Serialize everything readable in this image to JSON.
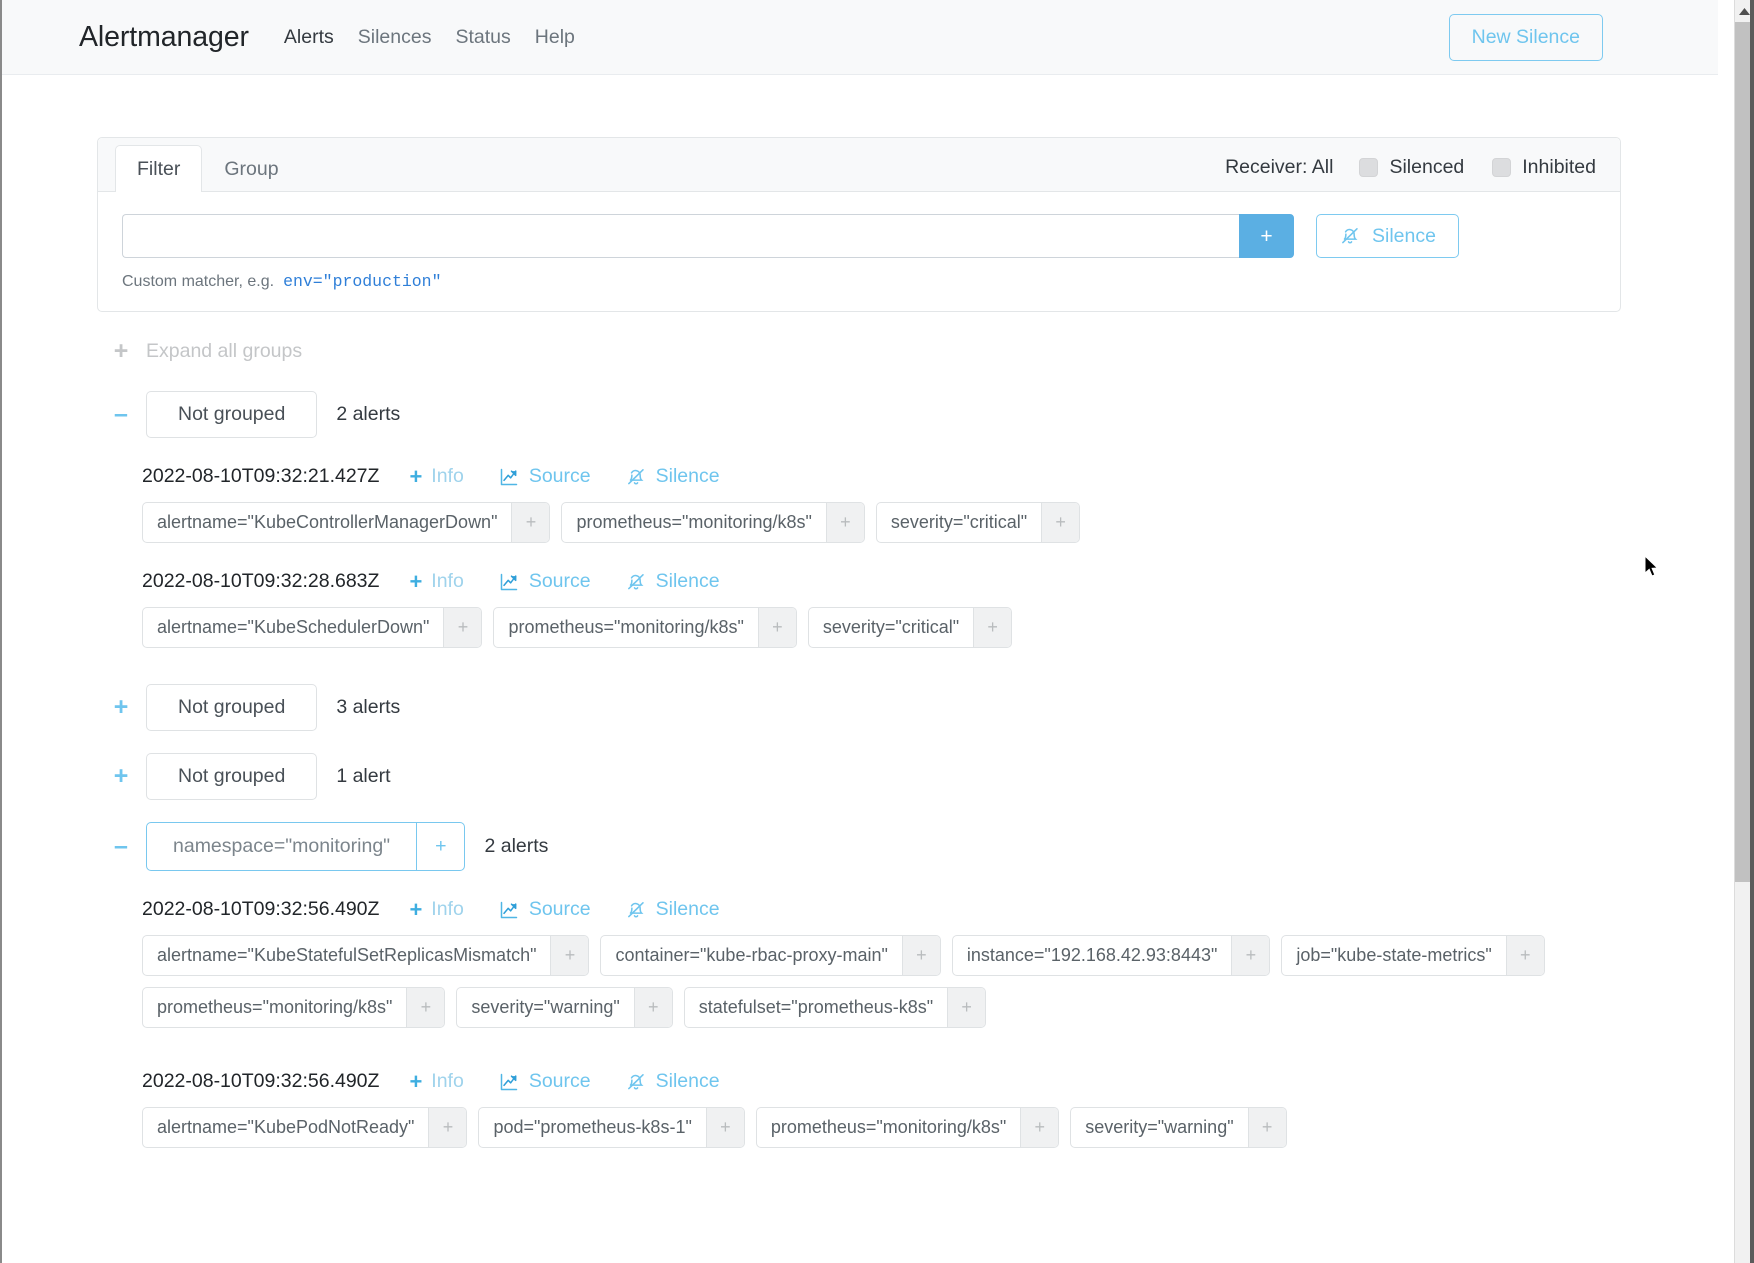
{
  "navbar": {
    "brand": "Alertmanager",
    "links": [
      {
        "label": "Alerts",
        "active": true
      },
      {
        "label": "Silences",
        "active": false
      },
      {
        "label": "Status",
        "active": false
      },
      {
        "label": "Help",
        "active": false
      }
    ],
    "new_silence_label": "New Silence"
  },
  "filter_card": {
    "tabs": [
      {
        "label": "Filter",
        "active": true
      },
      {
        "label": "Group",
        "active": false
      }
    ],
    "receiver_label": "Receiver: All",
    "checkboxes": [
      {
        "label": "Silenced",
        "checked": false
      },
      {
        "label": "Inhibited",
        "checked": false
      }
    ],
    "input_value": "",
    "input_placeholder": "",
    "add_button_label": "+",
    "silence_button_label": "Silence",
    "hint_prefix": "Custom matcher, e.g.",
    "hint_code": "env=\"production\""
  },
  "expand_all": {
    "icon": "plus-icon",
    "label": "Expand all groups"
  },
  "groups": [
    {
      "toggle": "minus-icon",
      "expanded": true,
      "chip_type": "plain",
      "chip_label": "Not grouped",
      "count_label": "2 alerts",
      "alerts": [
        {
          "timestamp": "2022-08-10T09:32:21.427Z",
          "info_label": "Info",
          "source_label": "Source",
          "silence_label": "Silence",
          "labels": [
            "alertname=\"KubeControllerManagerDown\"",
            "prometheus=\"monitoring/k8s\"",
            "severity=\"critical\""
          ]
        },
        {
          "timestamp": "2022-08-10T09:32:28.683Z",
          "info_label": "Info",
          "source_label": "Source",
          "silence_label": "Silence",
          "labels": [
            "alertname=\"KubeSchedulerDown\"",
            "prometheus=\"monitoring/k8s\"",
            "severity=\"critical\""
          ]
        }
      ]
    },
    {
      "toggle": "plus-icon",
      "expanded": false,
      "chip_type": "plain",
      "chip_label": "Not grouped",
      "count_label": "3 alerts",
      "alerts": []
    },
    {
      "toggle": "plus-icon",
      "expanded": false,
      "chip_type": "plain",
      "chip_label": "Not grouped",
      "count_label": "1 alert",
      "alerts": []
    },
    {
      "toggle": "minus-icon",
      "expanded": true,
      "chip_type": "split",
      "chip_label": "namespace=\"monitoring\"",
      "chip_plus": "+",
      "count_label": "2 alerts",
      "alerts": [
        {
          "timestamp": "2022-08-10T09:32:56.490Z",
          "info_label": "Info",
          "source_label": "Source",
          "silence_label": "Silence",
          "labels": [
            "alertname=\"KubeStatefulSetReplicasMismatch\"",
            "container=\"kube-rbac-proxy-main\"",
            "instance=\"192.168.42.93:8443\"",
            "job=\"kube-state-metrics\"",
            "prometheus=\"monitoring/k8s\"",
            "severity=\"warning\"",
            "statefulset=\"prometheus-k8s\""
          ]
        },
        {
          "timestamp": "2022-08-10T09:32:56.490Z",
          "info_label": "Info",
          "source_label": "Source",
          "silence_label": "Silence",
          "labels": [
            "alertname=\"KubePodNotReady\"",
            "pod=\"prometheus-k8s-1\"",
            "prometheus=\"monitoring/k8s\"",
            "severity=\"warning\""
          ]
        }
      ]
    }
  ],
  "chip_plus_label": "+",
  "colors": {
    "accent": "#6fc5ee",
    "accent_solid": "#5bafe3",
    "link": "#2f7fd8",
    "muted": "#6c757d",
    "text": "#212529",
    "card_border": "#e3e6e8",
    "header_bg": "#f8f9fa"
  }
}
